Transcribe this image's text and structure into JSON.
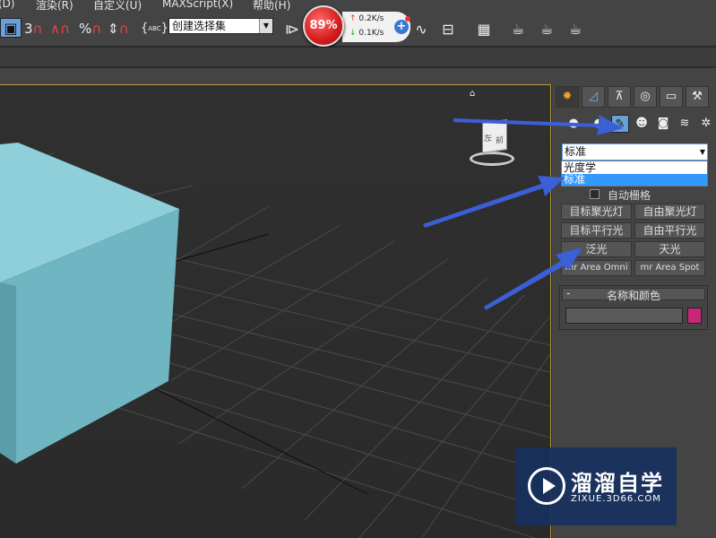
{
  "menu": {
    "items": [
      "(D)",
      "渲染(R)",
      "自定义(U)",
      "MAXScript(X)",
      "帮助(H)"
    ]
  },
  "toolbar": {
    "selection_set": "创建选择集",
    "snap_3": "3",
    "percent_snap": "%",
    "abc_label": "ABC"
  },
  "monitor": {
    "percent": "89%",
    "up_speed": "0.2K/s",
    "down_speed": "0.1K/s"
  },
  "viewcube": {
    "front_label": "前",
    "left_label": "左"
  },
  "panel": {
    "category_selected": "标准",
    "category_options": [
      "光度学",
      "标准"
    ],
    "auto_grid": "自动栅格",
    "light_buttons": [
      "目标聚光灯",
      "自由聚光灯",
      "目标平行光",
      "自由平行光",
      "泛光",
      "天光",
      "mr Area Omni",
      "mr Area Spot"
    ],
    "rollout_minus": "-",
    "rollout_title": "名称和颜色",
    "object_name": "",
    "object_color": "#c8287b"
  },
  "watermark": {
    "title": "溜溜自学",
    "url": "ZIXUE.3D66.COM"
  },
  "colors": {
    "box_front": "#6fb6c2",
    "box_top": "#8ecfda",
    "viewport_border": "#b79b3c",
    "arrow": "#3b5fd6"
  }
}
